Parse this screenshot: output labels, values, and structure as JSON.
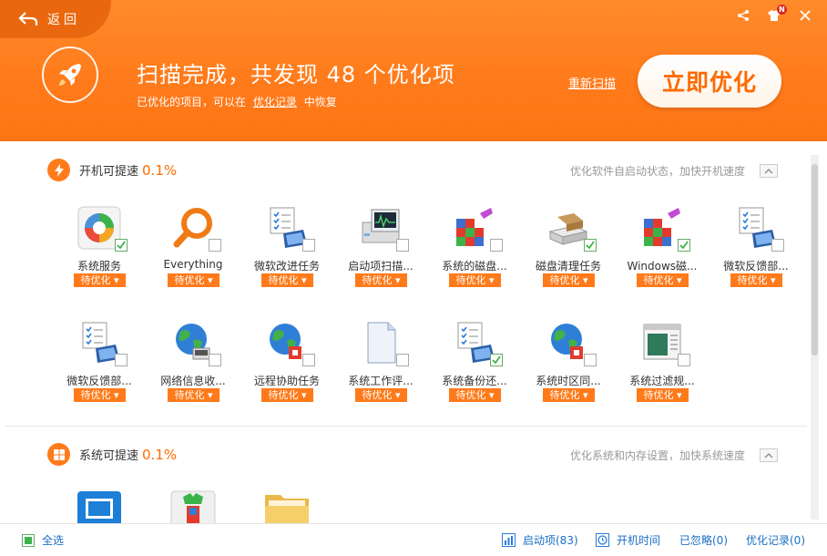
{
  "header": {
    "back_label": "返回",
    "scan_title": "扫描完成，共发现 48 个优化项",
    "scan_sub_prefix": "已优化的项目，可以在",
    "scan_sub_link": "优化记录",
    "scan_sub_suffix": "中恢复",
    "rescan_label": "重新扫描",
    "optimize_label": "立即优化",
    "badge_letter": "N"
  },
  "sections": [
    {
      "title": "开机可提速",
      "percent": "0.1%",
      "desc": "优化软件自启动状态，加快开机速度",
      "items": [
        {
          "name": "系统服务",
          "status": "待优化",
          "checked": true
        },
        {
          "name": "Everything",
          "status": "待优化",
          "checked": false
        },
        {
          "name": "微软改进任务",
          "status": "待优化",
          "checked": false
        },
        {
          "name": "启动项扫描...",
          "status": "待优化",
          "checked": false
        },
        {
          "name": "系统的磁盘...",
          "status": "待优化",
          "checked": false
        },
        {
          "name": "磁盘清理任务",
          "status": "待优化",
          "checked": true
        },
        {
          "name": "Windows磁...",
          "status": "待优化",
          "checked": true
        },
        {
          "name": "微软反馈部...",
          "status": "待优化",
          "checked": false
        },
        {
          "name": "微软反馈部...",
          "status": "待优化",
          "checked": false
        },
        {
          "name": "网络信息收...",
          "status": "待优化",
          "checked": false
        },
        {
          "name": "远程协助任务",
          "status": "待优化",
          "checked": false
        },
        {
          "name": "系统工作评...",
          "status": "待优化",
          "checked": false
        },
        {
          "name": "系统备份还...",
          "status": "待优化",
          "checked": true
        },
        {
          "name": "系统时区同...",
          "status": "待优化",
          "checked": false
        },
        {
          "name": "系统过滤规...",
          "status": "待优化",
          "checked": false
        }
      ]
    },
    {
      "title": "系统可提速",
      "percent": "0.1%",
      "desc": "优化系统和内存设置，加快系统速度"
    }
  ],
  "footer": {
    "select_all": "全选",
    "startup_items": "启动项(83)",
    "boot_time": "开机时间",
    "ignored": "已忽略(0)",
    "opt_history": "优化记录(0)"
  },
  "colors": {
    "accent": "#ff7a1a",
    "accent_dark": "#e9680f",
    "link": "#1a6fc4",
    "check_green": "#3cb34a"
  }
}
